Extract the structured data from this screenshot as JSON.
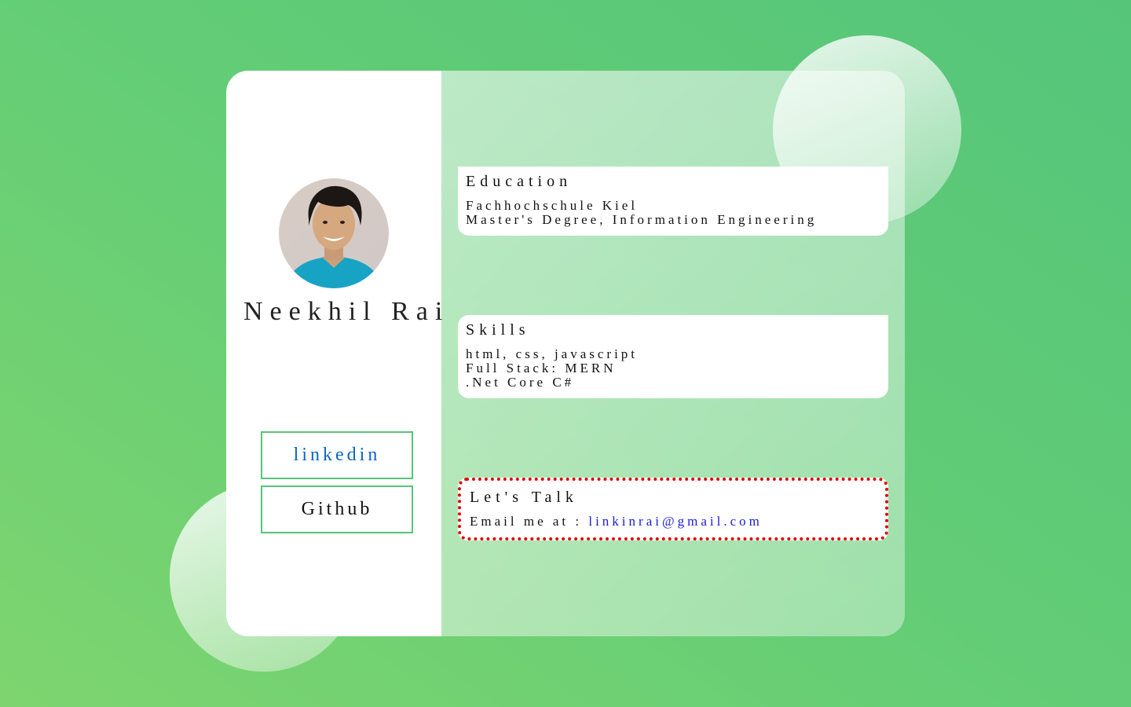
{
  "profile": {
    "name": "Neekhil Rai",
    "avatar_icon": "profile-photo",
    "links": [
      {
        "label": "linkedin",
        "color": "#0a66c2"
      },
      {
        "label": "Github",
        "color": "#111111"
      }
    ]
  },
  "education": {
    "title": "Education",
    "lines": [
      "Fachhochschule Kiel",
      "Master's Degree, Information Engineering"
    ]
  },
  "skills": {
    "title": "Skills",
    "lines": [
      "html, css, javascript",
      "Full Stack: MERN",
      ".Net Core C#"
    ]
  },
  "contact": {
    "title": "Let's Talk",
    "prefix": "Email me at : ",
    "email": "linkinrai@gmail.com"
  },
  "colors": {
    "background_from": "#7ed56f",
    "background_to": "#55c57a",
    "button_border": "#55c57a",
    "contact_border": "#e00000",
    "email_link": "#1a1ad8"
  }
}
